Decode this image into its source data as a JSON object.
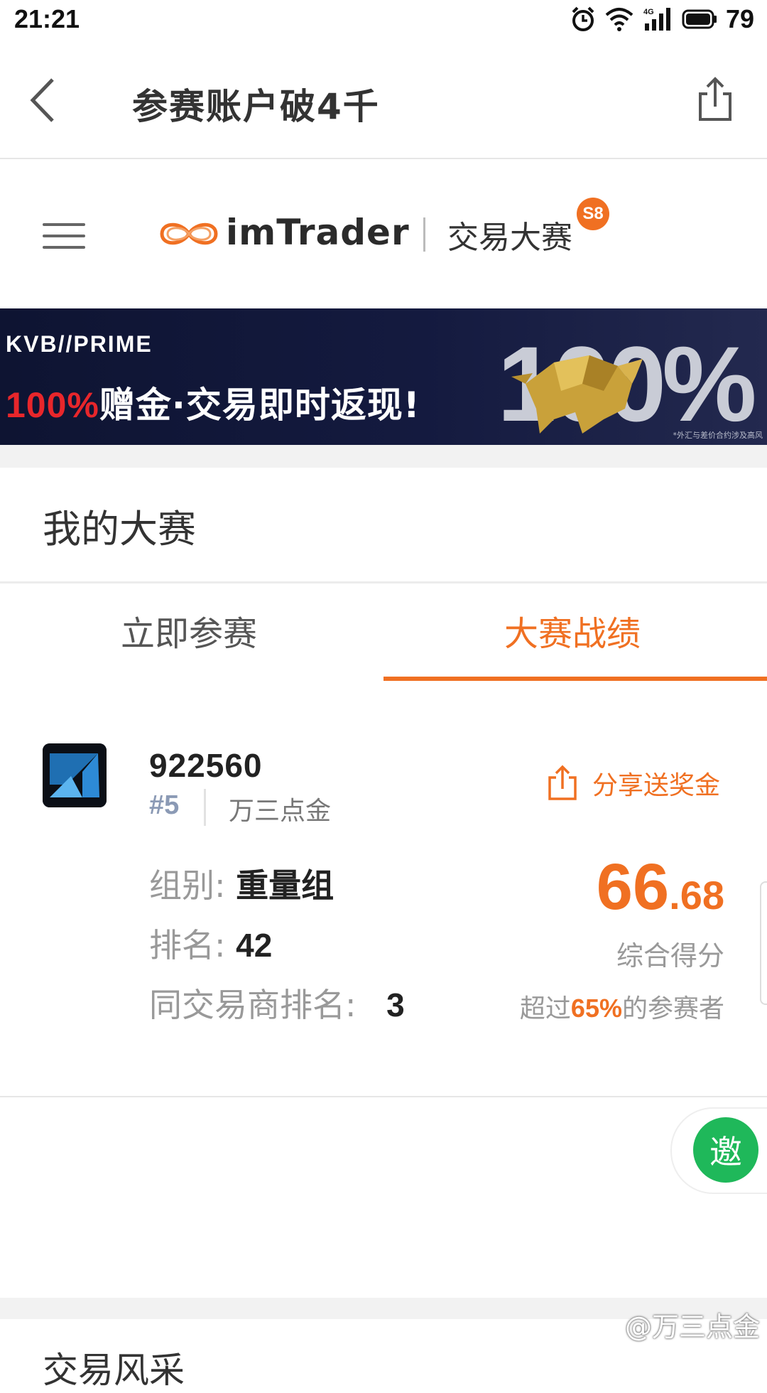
{
  "status_bar": {
    "time": "21:21",
    "battery": "79",
    "network": "4G"
  },
  "nav": {
    "title": "参赛账户破4千"
  },
  "brand": {
    "logo_text": "imTrader",
    "subtitle": "交易大赛",
    "season_badge": "S8"
  },
  "banner": {
    "brand": "KVB//PRIME",
    "percent": "100%",
    "slogan": "赠金·交易即时返现!",
    "big_text": "100%",
    "note": "*外汇与差价合约涉及高风"
  },
  "section": {
    "title": "我的大赛"
  },
  "tabs": [
    {
      "label": "立即参赛",
      "active": false
    },
    {
      "label": "大赛战绩",
      "active": true
    }
  ],
  "account": {
    "id": "922560",
    "rank_tag": "#5",
    "name": "万三点金",
    "share_label": "分享送奖金",
    "group_label": "组别:",
    "group_value": "重量组",
    "ranking_label": "排名:",
    "ranking_value": "42",
    "broker_rank_label": "同交易商排名:",
    "broker_rank_value": "3",
    "score_int": "66",
    "score_dec": ".68",
    "score_label": "综合得分",
    "exceed_prefix": "超过",
    "exceed_pct": "65%",
    "exceed_suffix": "的参赛者"
  },
  "invite": {
    "label": "邀"
  },
  "next_section": {
    "title": "交易风采"
  },
  "watermark": "@万三点金",
  "colors": {
    "accent": "#f07022",
    "invite_green": "#1fb85a",
    "banner_bg": "#141a3f"
  }
}
